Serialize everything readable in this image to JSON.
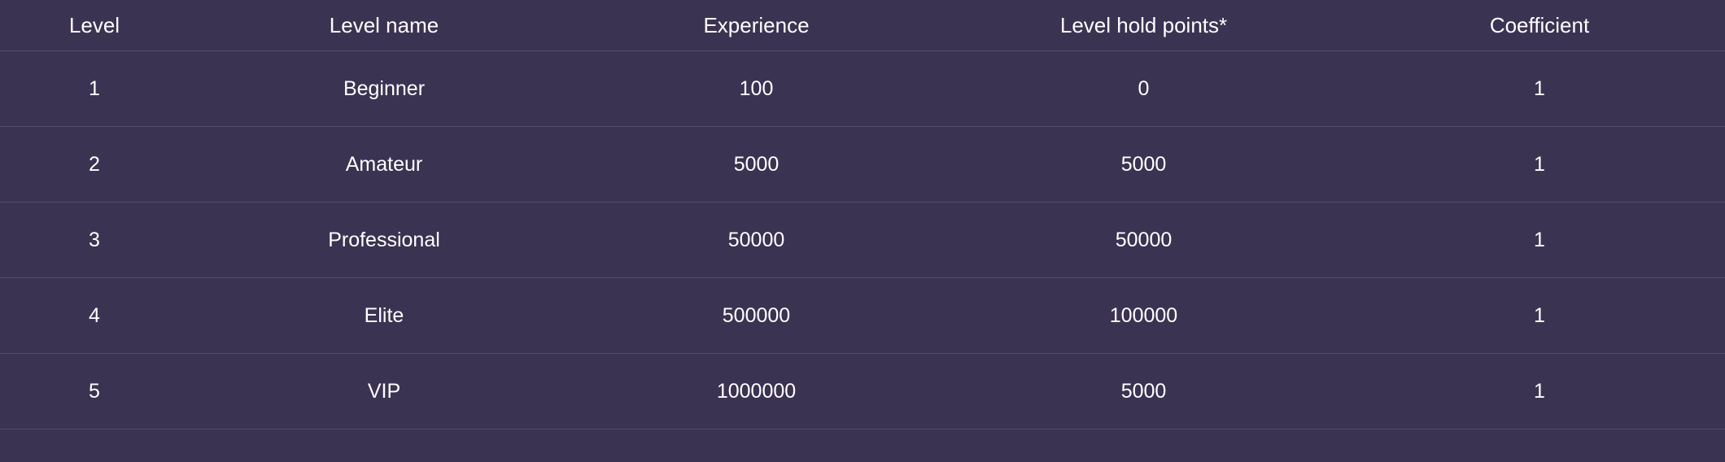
{
  "table": {
    "name": "levels-table",
    "columns": [
      {
        "key": "level",
        "label": "Level"
      },
      {
        "key": "level_name",
        "label": "Level name"
      },
      {
        "key": "experience",
        "label": "Experience"
      },
      {
        "key": "level_hold_points",
        "label": "Level hold points*"
      },
      {
        "key": "coefficient",
        "label": "Coefficient"
      }
    ],
    "rows": [
      {
        "level": "1",
        "level_name": "Beginner",
        "experience": "100",
        "level_hold_points": "0",
        "coefficient": "1"
      },
      {
        "level": "2",
        "level_name": "Amateur",
        "experience": "5000",
        "level_hold_points": "5000",
        "coefficient": "1"
      },
      {
        "level": "3",
        "level_name": "Professional",
        "experience": "50000",
        "level_hold_points": "50000",
        "coefficient": "1"
      },
      {
        "level": "4",
        "level_name": "Elite",
        "experience": "500000",
        "level_hold_points": "100000",
        "coefficient": "1"
      },
      {
        "level": "5",
        "level_name": "VIP",
        "experience": "1000000",
        "level_hold_points": "5000",
        "coefficient": "1"
      }
    ]
  },
  "colors": {
    "background": "#3a3352",
    "text": "#ffffff",
    "row_divider": "#554d70"
  }
}
